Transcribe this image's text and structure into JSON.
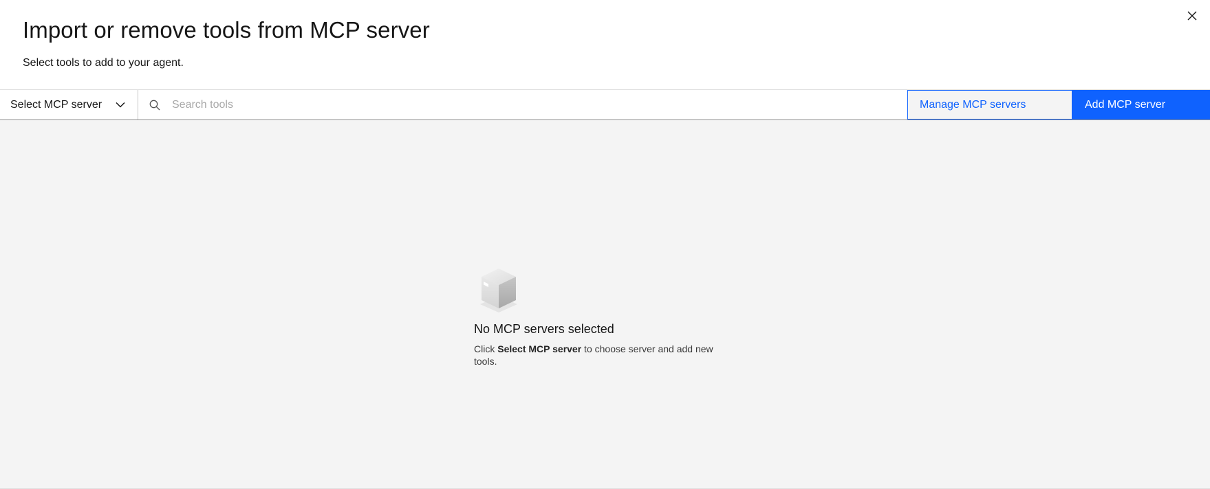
{
  "modal": {
    "title": "Import or remove tools from MCP server",
    "subtitle": "Select tools to add to your agent.",
    "close_icon": "close-icon"
  },
  "toolbar": {
    "server_select_label": "Select MCP server",
    "server_select_icon": "chevron-down-icon",
    "search_placeholder": "Search tools",
    "search_value": "",
    "search_icon": "search-icon",
    "manage_button_label": "Manage MCP servers",
    "add_button_label": "Add MCP server"
  },
  "empty_state": {
    "icon": "package-box-icon",
    "title": "No MCP servers selected",
    "desc_prefix": "Click ",
    "desc_bold": "Select MCP server",
    "desc_suffix": " to choose server and add new tools."
  },
  "colors": {
    "primary": "#0f62fe",
    "background": "#f4f4f4",
    "text": "#161616"
  }
}
